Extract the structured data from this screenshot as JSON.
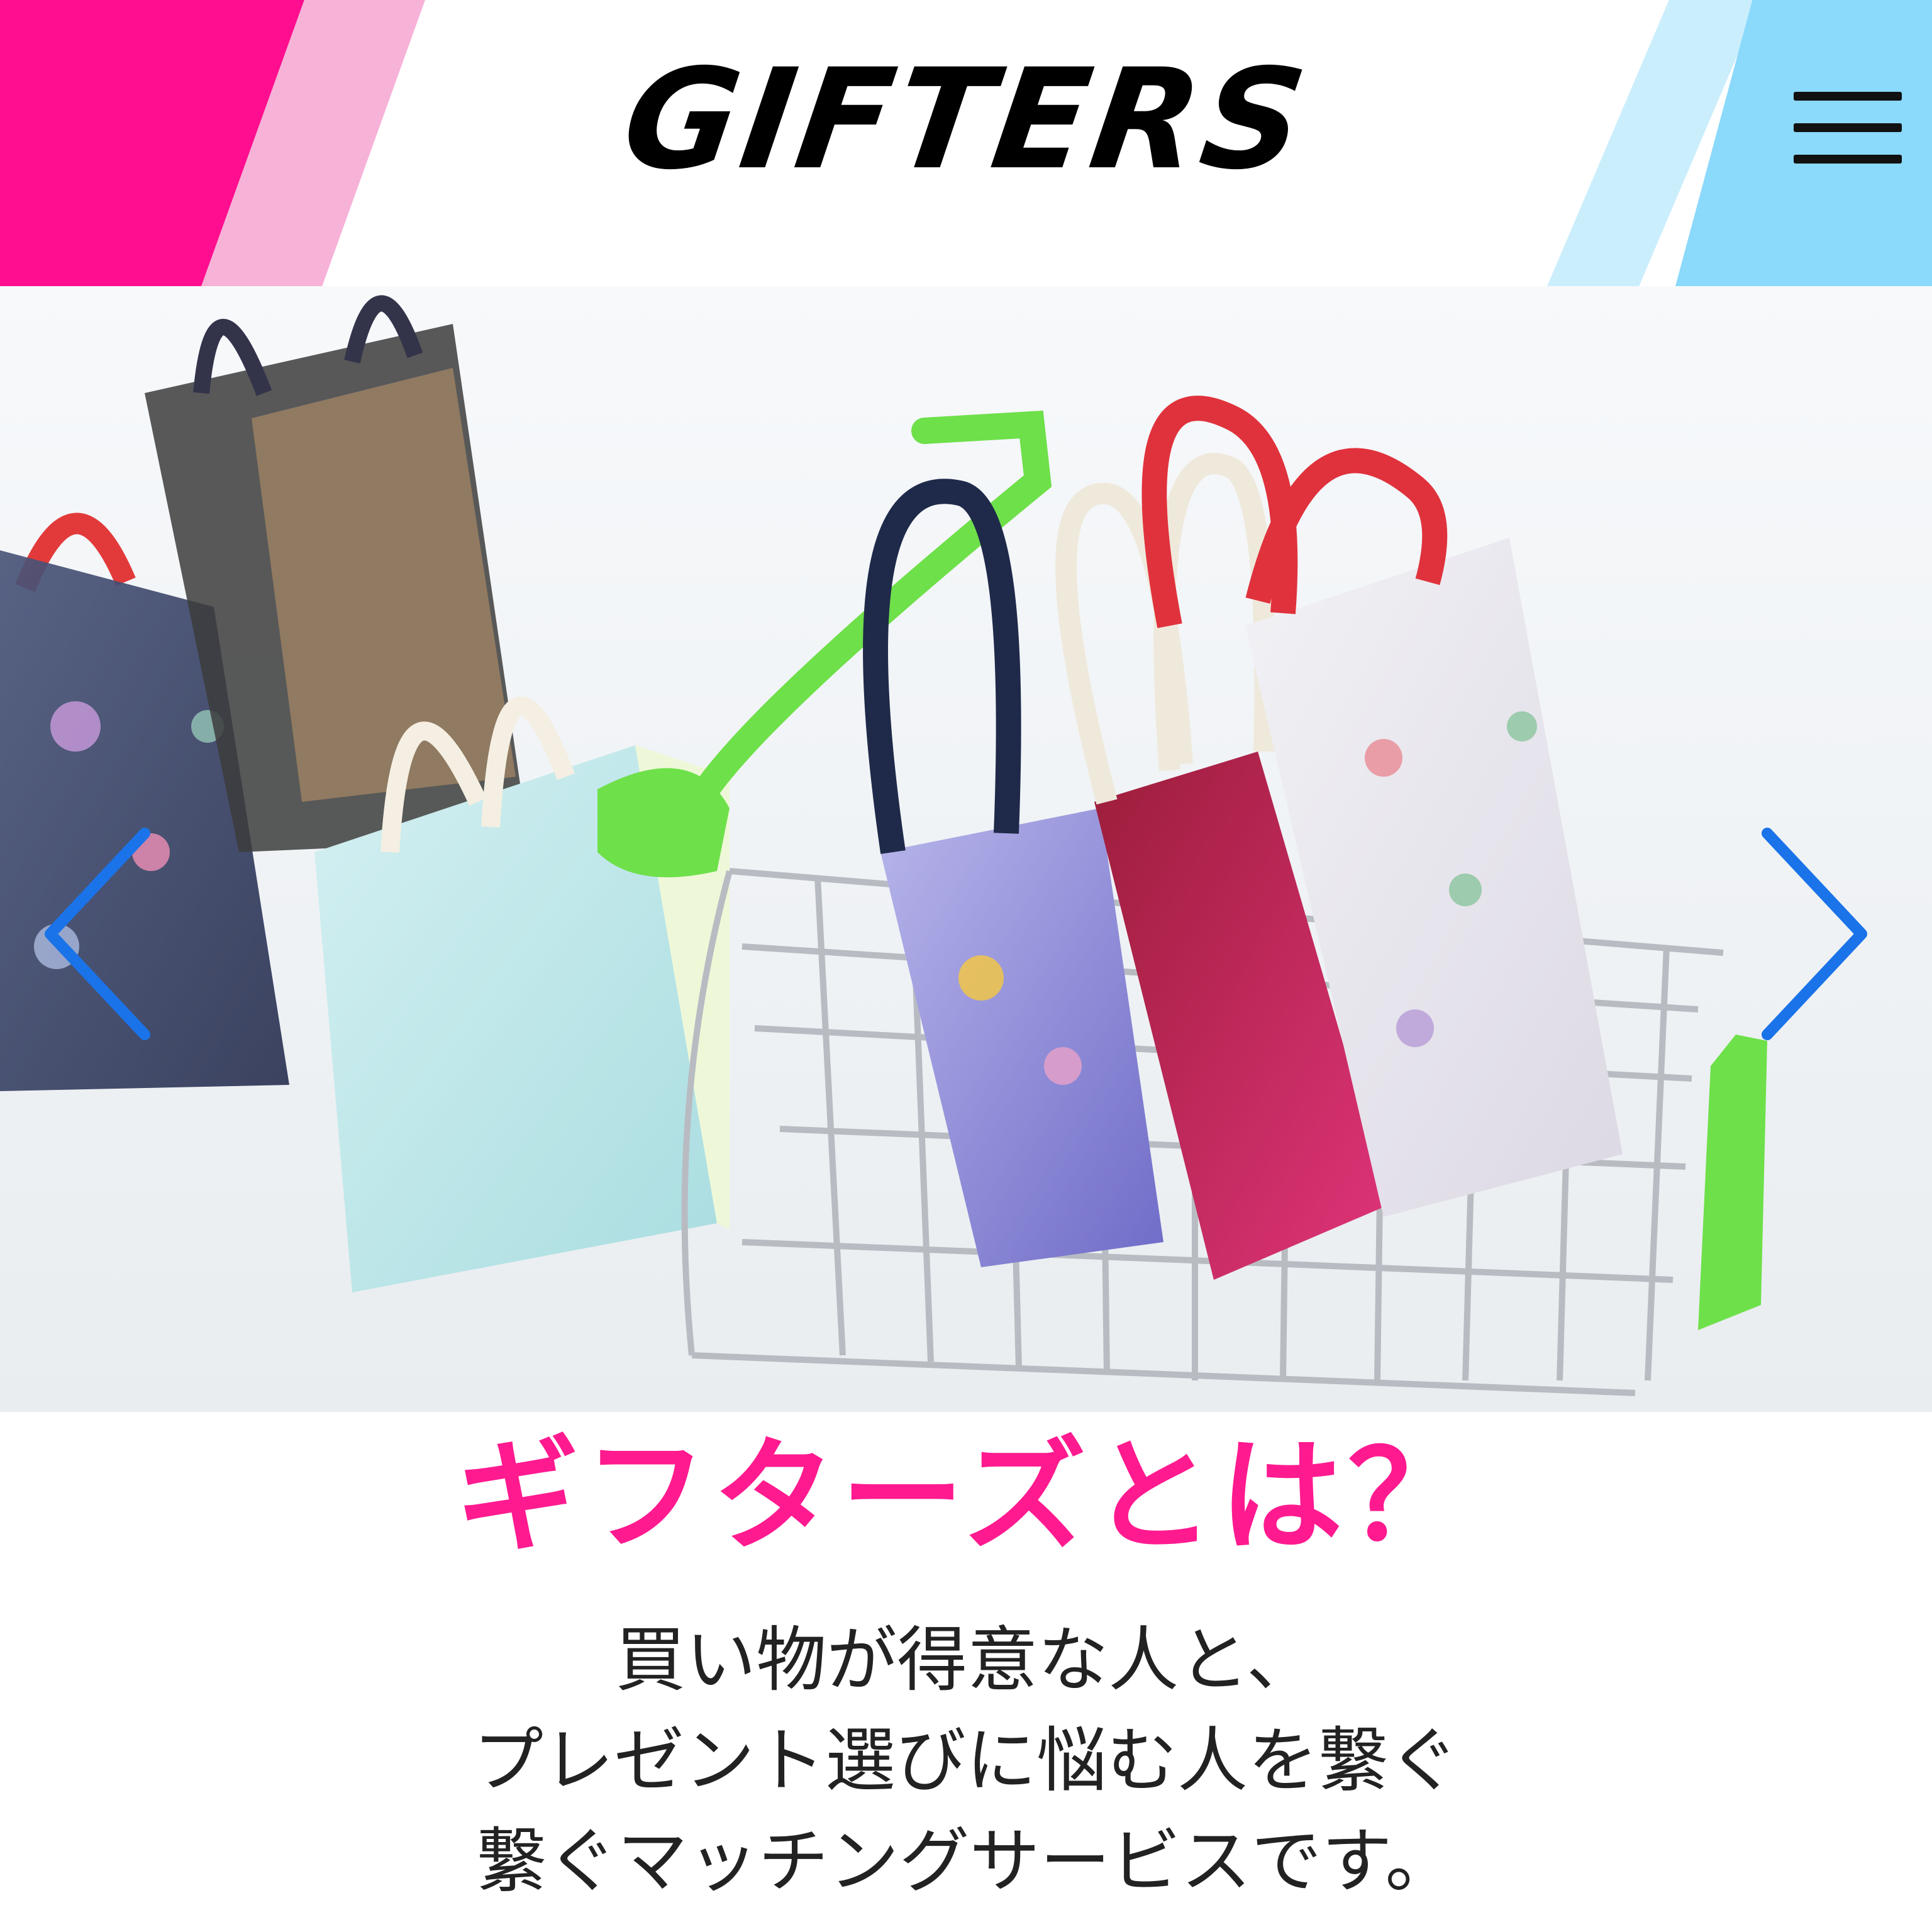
{
  "header": {
    "logo_text": "GIFTERS",
    "menu_icon": "hamburger-menu-icon",
    "stripe_colors": {
      "left_primary": "#ff0f8f",
      "left_secondary": "#f7b2d8",
      "right_secondary": "#cbeefd",
      "right_primary": "#8bd9fb"
    }
  },
  "hero": {
    "prev_icon": "chevron-left-icon",
    "next_icon": "chevron-right-icon",
    "arrow_color": "#1a73e8"
  },
  "intro": {
    "title": "ギフターズとは？",
    "title_color": "#ff1a8f",
    "lines": [
      "買い物が得意な人と、",
      "プレゼント選びに悩む人を繋ぐ",
      "繋ぐマッチングサービスです。"
    ]
  }
}
